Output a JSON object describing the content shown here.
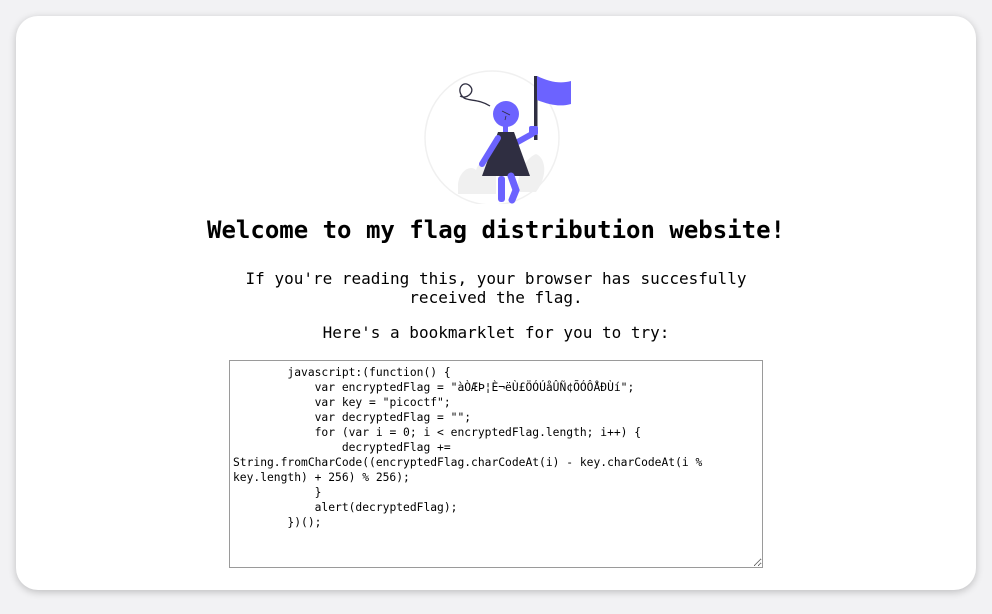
{
  "page": {
    "heading": "Welcome to my flag distribution website!",
    "message_line1": "If you're reading this, your browser has succesfully received the flag.",
    "message_line2": "Here's a bookmarklet for you to try:"
  },
  "bookmarklet": {
    "code": "        javascript:(function() {\n            var encryptedFlag = \"àÒÆÞ¦È¬ëÙ£ÖÓÚåÛÑ¢ÕÓÔÅÐÙí\";\n            var key = \"picoctf\";\n            var decryptedFlag = \"\";\n            for (var i = 0; i < encryptedFlag.length; i++) {\n                decryptedFlag += String.fromCharCode((encryptedFlag.charCodeAt(i) - key.charCodeAt(i % key.length) + 256) % 256);\n            }\n            alert(decryptedFlag);\n        })();"
  },
  "colors": {
    "accent": "#6c63ff",
    "dark": "#2f2e41",
    "light_gray": "#f2f2f2"
  },
  "icons": {
    "illustration": "person-holding-flag-illustration"
  }
}
